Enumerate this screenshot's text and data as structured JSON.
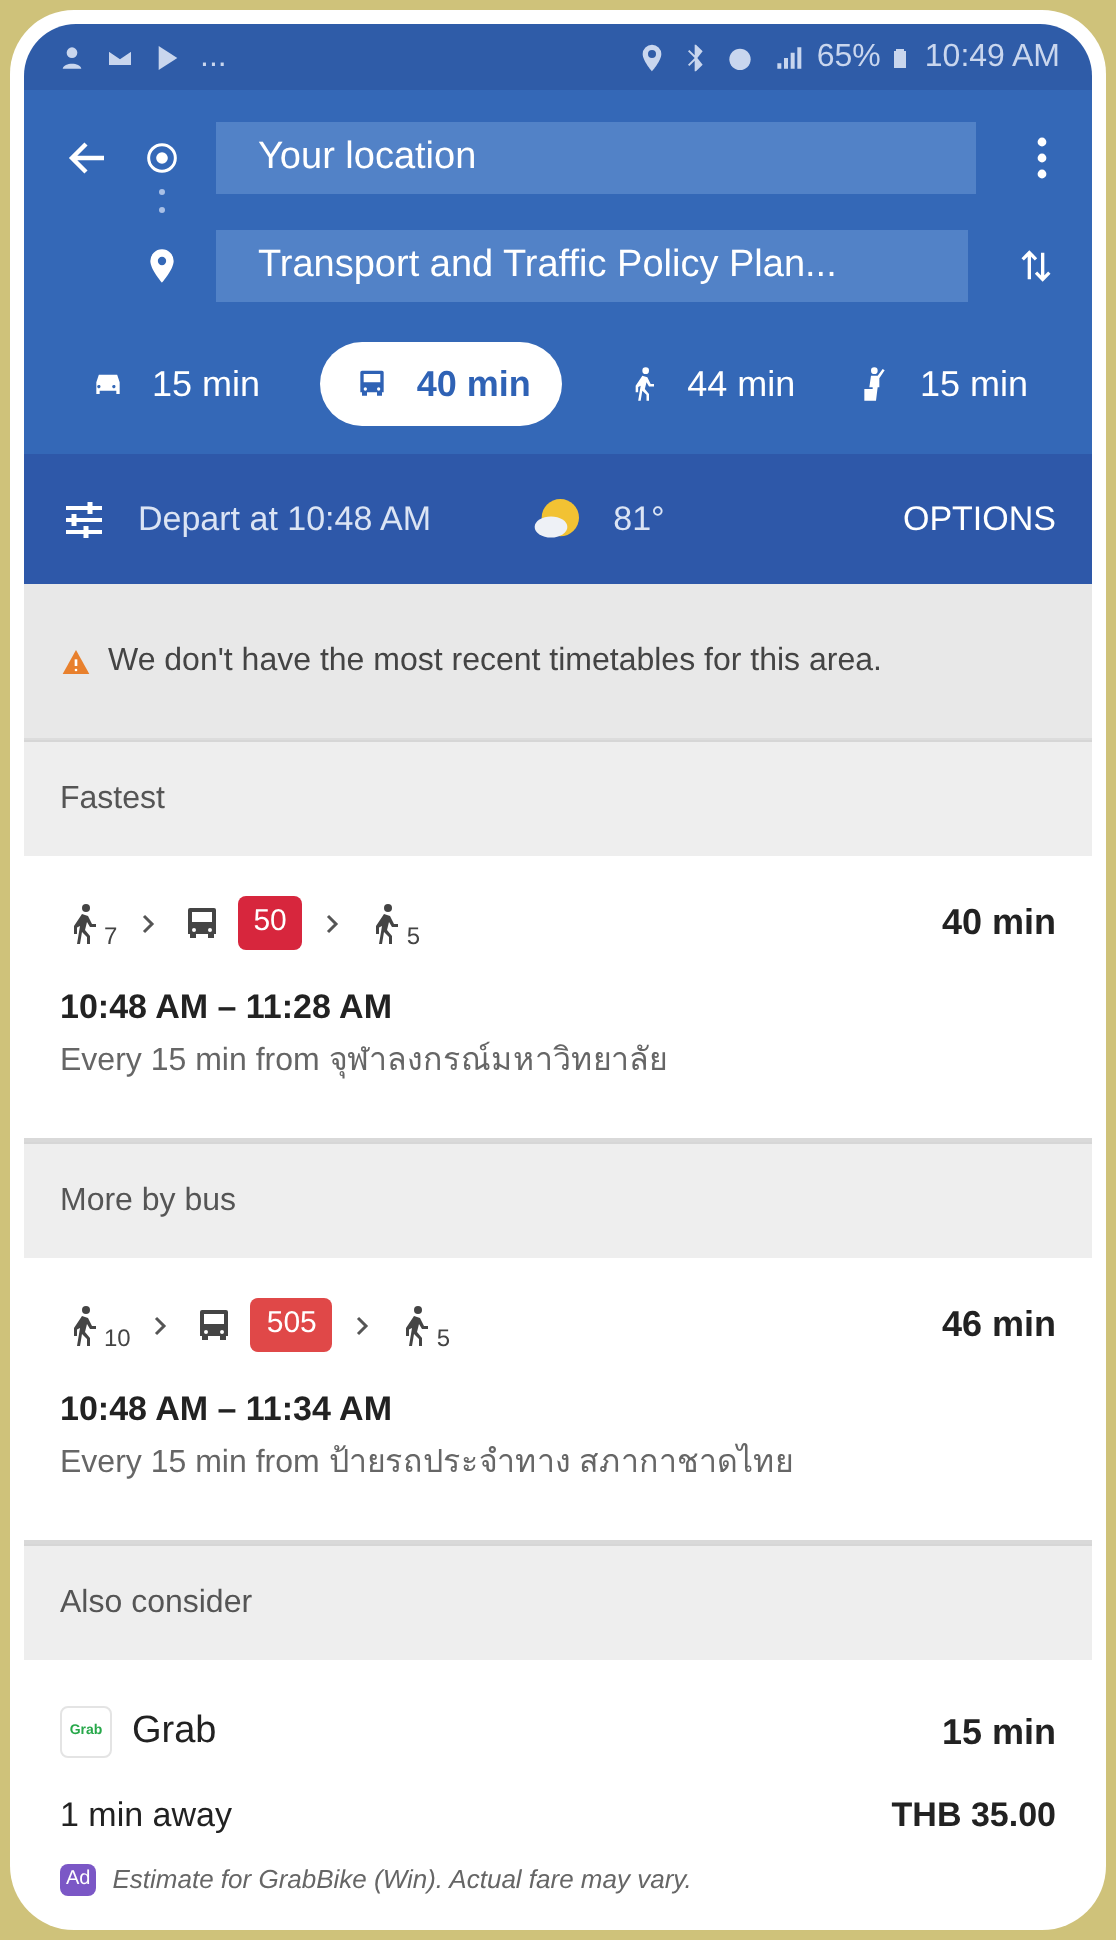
{
  "status_bar": {
    "notifications_more": "...",
    "battery": "65%",
    "time": "10:49 AM"
  },
  "directions": {
    "origin": "Your location",
    "destination": "Transport and Traffic Policy Plan..."
  },
  "travel_modes": [
    {
      "kind": "car",
      "label": "15 min",
      "selected": false
    },
    {
      "kind": "transit",
      "label": "40 min",
      "selected": true
    },
    {
      "kind": "walk",
      "label": "44 min",
      "selected": false
    },
    {
      "kind": "rideshare",
      "label": "15 min",
      "selected": false
    }
  ],
  "options_bar": {
    "depart": "Depart at 10:48 AM",
    "temperature": "81°",
    "options_button": "OPTIONS"
  },
  "warning": "We don't have the most recent timetables for this area.",
  "sections": [
    {
      "title": "Fastest",
      "routes": [
        {
          "steps": [
            {
              "kind": "walk",
              "minutes": "7"
            },
            {
              "kind": "bus",
              "line": "50",
              "color": "#d7263d"
            },
            {
              "kind": "walk",
              "minutes": "5"
            }
          ],
          "duration": "40 min",
          "times": "10:48 AM – 11:28 AM",
          "frequency": "Every 15 min from จุฬาลงกรณ์มหาวิทยาลัย"
        }
      ]
    },
    {
      "title": "More by bus",
      "routes": [
        {
          "steps": [
            {
              "kind": "walk",
              "minutes": "10"
            },
            {
              "kind": "bus",
              "line": "505",
              "color": "#e04848"
            },
            {
              "kind": "walk",
              "minutes": "5"
            }
          ],
          "duration": "46 min",
          "times": "10:48 AM – 11:34 AM",
          "frequency": "Every 15 min from ป้ายรถประจำทาง สภากาชาดไทย"
        }
      ]
    },
    {
      "title": "Also consider",
      "rideshare": {
        "logo_text": "Grab",
        "name": "Grab",
        "duration": "15 min",
        "pickup": "1 min away",
        "price": "THB 35.00",
        "ad_badge": "Ad",
        "note": "Estimate for GrabBike (Win). Actual fare may vary."
      }
    }
  ]
}
